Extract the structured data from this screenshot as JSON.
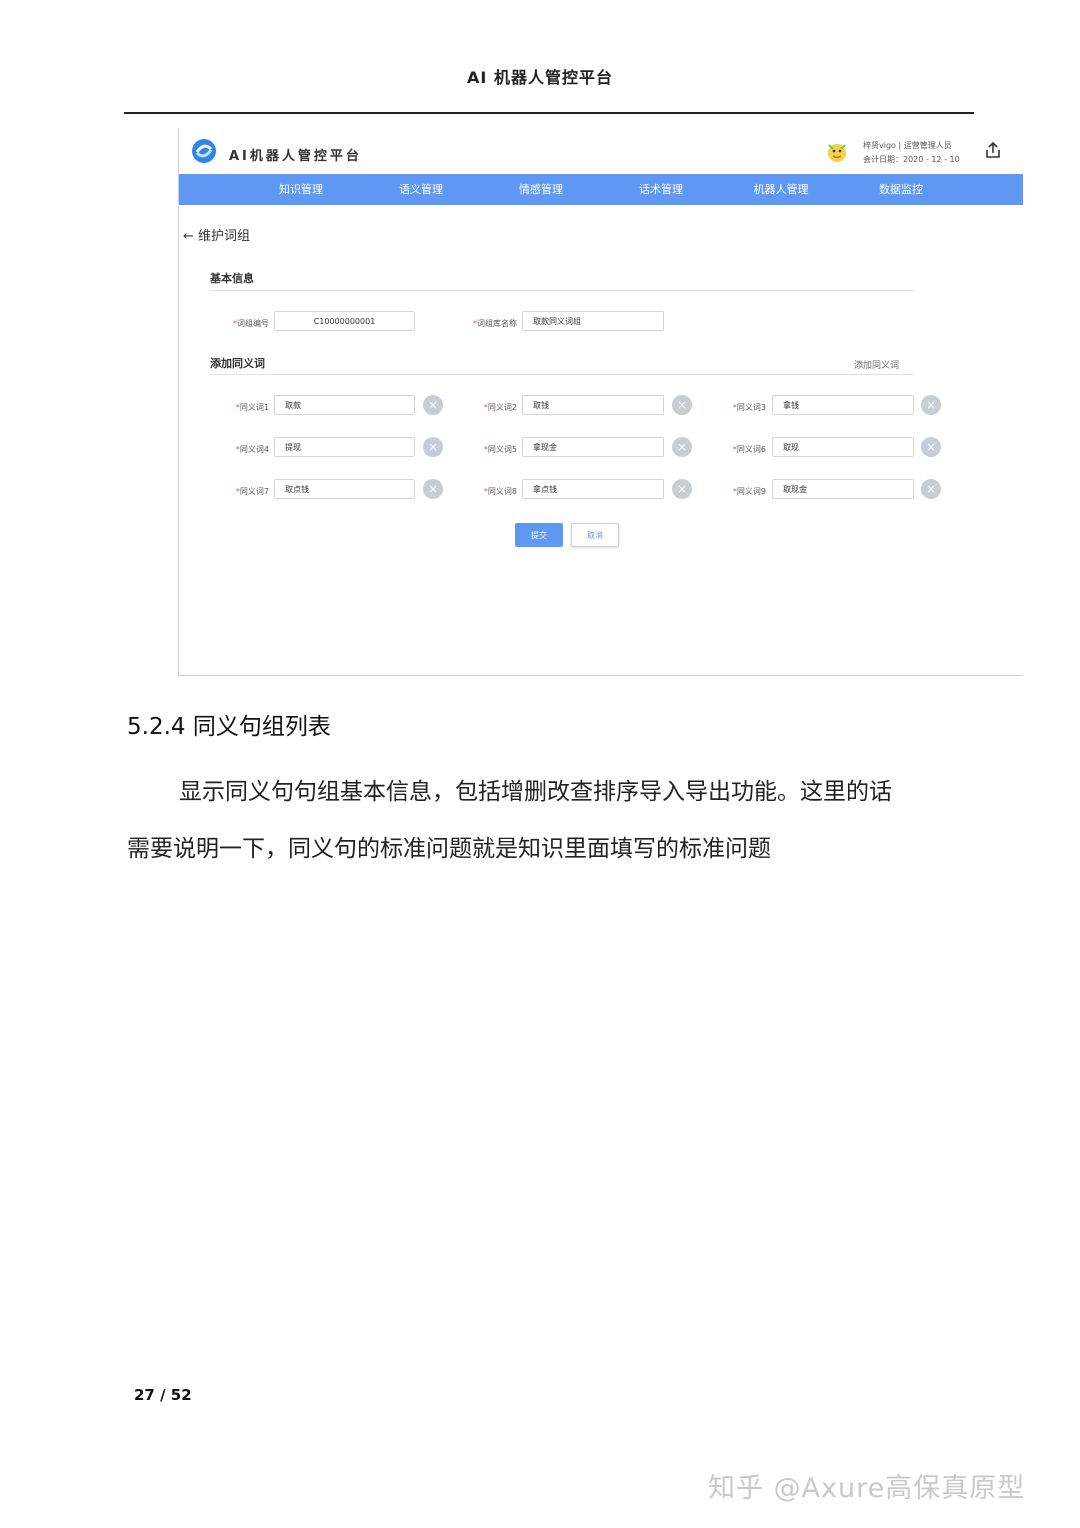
{
  "doc_header": "AI 机器人管控平台",
  "app": {
    "title": "AI机器人管控平台",
    "user_line1": "梓贤vigo | 运营管理人员",
    "user_line2": "会计日期：2020 - 12 - 10",
    "nav": [
      "知识管理",
      "语义管理",
      "情感管理",
      "话术管理",
      "机器人管理",
      "数据监控"
    ],
    "back_label": "维护词组",
    "basic_info_title": "基本信息",
    "group_id_label": "词组编号",
    "group_id_value": "C10000000001",
    "group_name_label": "词组库名称",
    "group_name_value": "取款同义词组",
    "add_synonym_title": "添加同义词",
    "add_synonym_link": "添加同义词",
    "required_mark": "*",
    "clear_glyph": "×",
    "synonyms": [
      {
        "label": "同义词1",
        "value": "取款"
      },
      {
        "label": "同义词2",
        "value": "取钱"
      },
      {
        "label": "同义词3",
        "value": "拿钱"
      },
      {
        "label": "同义词4",
        "value": "提现"
      },
      {
        "label": "同义词5",
        "value": "拿现金"
      },
      {
        "label": "同义词6",
        "value": "取现"
      },
      {
        "label": "同义词7",
        "value": "取点钱"
      },
      {
        "label": "同义词8",
        "value": "拿点钱"
      },
      {
        "label": "同义词9",
        "value": "取现金"
      }
    ],
    "submit_label": "提交",
    "cancel_label": "取消",
    "colors": {
      "nav_bg": "#5f98f2",
      "required": "#e5534b"
    }
  },
  "doc": {
    "heading": "5.2.4  同义句组列表",
    "para_line1": "显示同义句句组基本信息，包括增删改查排序导入导出功能。这里的话",
    "para_line2": "需要说明一下，同义句的标准问题就是知识里面填写的标准问题",
    "page_number": "27  /  52",
    "watermark": "知乎 @Axure高保真原型"
  }
}
